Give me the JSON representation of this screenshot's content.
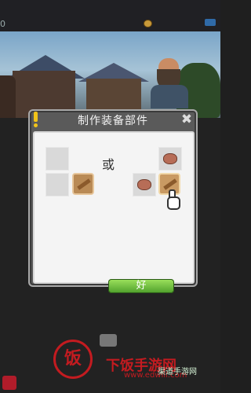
{
  "topbar": {
    "left_value": "0"
  },
  "dialog": {
    "title": "制作装备部件",
    "or_text": "或",
    "confirm_label": "好"
  },
  "watermark": {
    "logo_char": "饭",
    "site_name": "下饭手游网",
    "url": "www.edwill.com",
    "secondary": "渠道手游网"
  },
  "colors": {
    "dialog_bg": "#5a5a5a",
    "panel_bg": "#f4f4f4",
    "button_green": "#4e9f2b",
    "warning_yellow": "#f1c419",
    "watermark_red": "#c31b20"
  }
}
